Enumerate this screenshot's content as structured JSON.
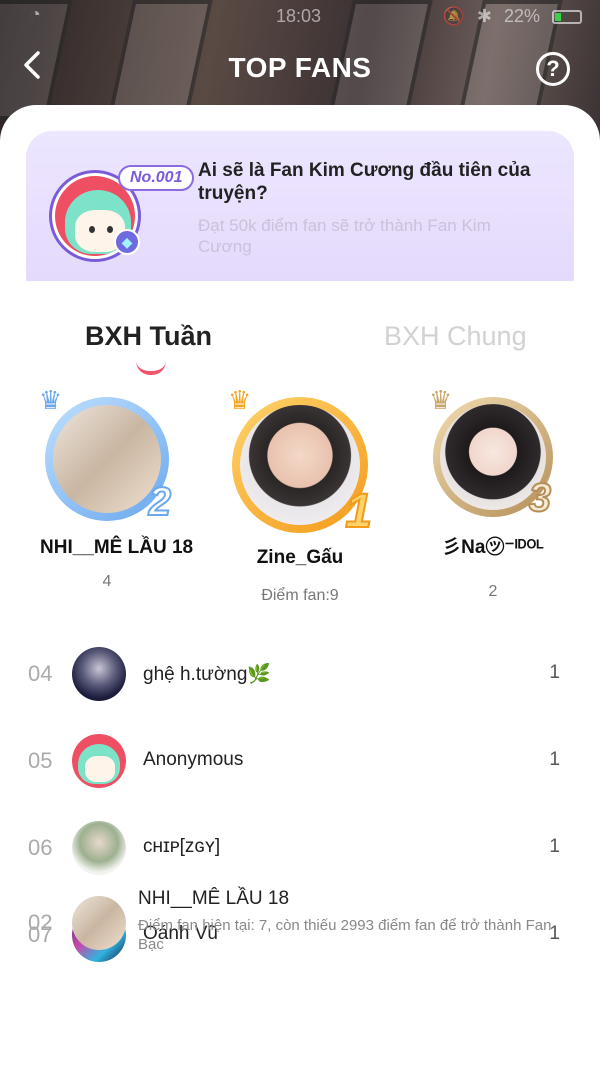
{
  "status_bar": {
    "time": "18:03",
    "battery": "22%"
  },
  "header": {
    "back_label": "<",
    "title": "TOP FANS",
    "help_label": "?"
  },
  "promo": {
    "badge": "No.001",
    "title": "Ai sẽ là Fan Kim Cương đầu tiên của truyện?",
    "subtitle": "Đạt 50k điểm fan sẽ trở thành Fan Kim Cương"
  },
  "tabs": {
    "week": "BXH Tuần",
    "general": "BXH Chung",
    "active": "week"
  },
  "podium": [
    {
      "rank": "2",
      "name": "NHI__MÊ LẦU 18",
      "score": "4"
    },
    {
      "rank": "1",
      "name": "Zine_Gấu",
      "score": "Điểm fan:9"
    },
    {
      "rank": "3",
      "name": "彡Na㋡⁻ᴵᴰᴼᴸ",
      "score": "2"
    }
  ],
  "ranking": [
    {
      "rank": "04",
      "name": "ghệ h.tường🌿",
      "score": "1"
    },
    {
      "rank": "05",
      "name": "Anonymous",
      "score": "1"
    },
    {
      "rank": "06",
      "name": "ᴄʜɪᴘ[ᴢɢʏ]",
      "score": "1"
    },
    {
      "rank": "07",
      "name": "Oánh Vũ",
      "score": "1"
    }
  ],
  "me": {
    "rank": "02",
    "name": "NHI__MÊ LẦU 18",
    "desc": "Điểm fan hiện tại: 7, còn thiếu 2993 điểm fan để trở thành Fan Bạc"
  },
  "colors": {
    "accent": "#f2536c",
    "promo_bg": "#e8e0fd",
    "gold": "#f5a623",
    "silver": "#7db6f2",
    "bronze": "#c9a66b"
  }
}
